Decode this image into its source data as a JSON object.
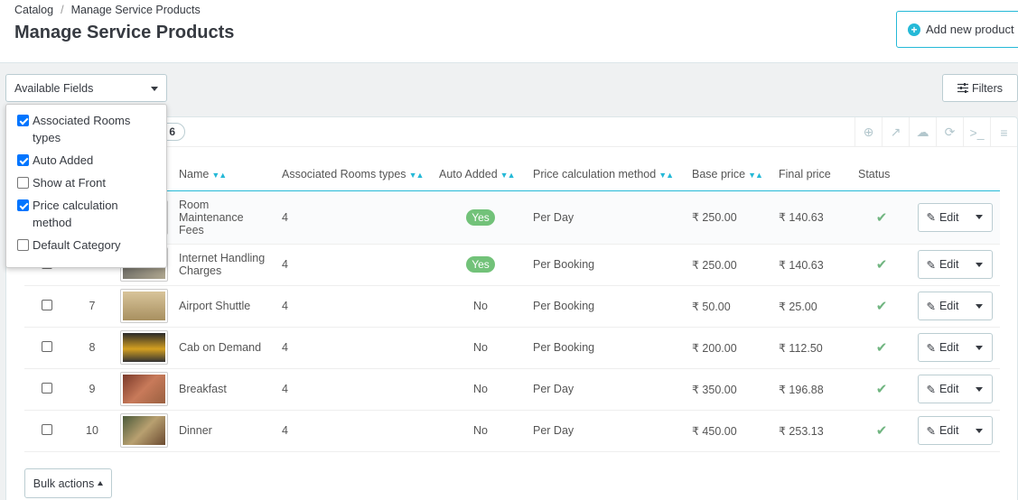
{
  "breadcrumb": {
    "parent": "Catalog",
    "current": "Manage Service Products"
  },
  "page_title": "Manage Service Products",
  "add_product_label": "Add new product",
  "available_fields": {
    "label": "Available Fields",
    "options": [
      {
        "label": "Associated Rooms types",
        "checked": true
      },
      {
        "label": "Auto Added",
        "checked": true
      },
      {
        "label": "Show at Front",
        "checked": false
      },
      {
        "label": "Price calculation method",
        "checked": true
      },
      {
        "label": "Default Category",
        "checked": false
      }
    ]
  },
  "filters_label": "Filters",
  "count": "6",
  "columns": {
    "name": "Name",
    "assoc": "Associated Rooms types",
    "auto": "Auto Added",
    "price_method": "Price calculation method",
    "base": "Base price",
    "final": "Final price",
    "status": "Status"
  },
  "rows": [
    {
      "id": "",
      "name": "Room Maintenance Fees",
      "assoc": "4",
      "auto": "Yes",
      "method": "Per Day",
      "base": "₹ 250.00",
      "final": "₹ 140.63",
      "edit": "Edit"
    },
    {
      "id": "",
      "name": "Internet Handling Charges",
      "assoc": "4",
      "auto": "Yes",
      "method": "Per Booking",
      "base": "₹ 250.00",
      "final": "₹ 140.63",
      "edit": "Edit"
    },
    {
      "id": "7",
      "name": "Airport Shuttle",
      "assoc": "4",
      "auto": "No",
      "method": "Per Booking",
      "base": "₹ 50.00",
      "final": "₹ 25.00",
      "edit": "Edit"
    },
    {
      "id": "8",
      "name": "Cab on Demand",
      "assoc": "4",
      "auto": "No",
      "method": "Per Booking",
      "base": "₹ 200.00",
      "final": "₹ 112.50",
      "edit": "Edit"
    },
    {
      "id": "9",
      "name": "Breakfast",
      "assoc": "4",
      "auto": "No",
      "method": "Per Day",
      "base": "₹ 350.00",
      "final": "₹ 196.88",
      "edit": "Edit"
    },
    {
      "id": "10",
      "name": "Dinner",
      "assoc": "4",
      "auto": "No",
      "method": "Per Day",
      "base": "₹ 450.00",
      "final": "₹ 253.13",
      "edit": "Edit"
    }
  ],
  "bulk_actions_label": "Bulk actions",
  "colors": {
    "accent": "#25b9d7",
    "yes_badge": "#72c279",
    "status_check": "#70b580"
  }
}
